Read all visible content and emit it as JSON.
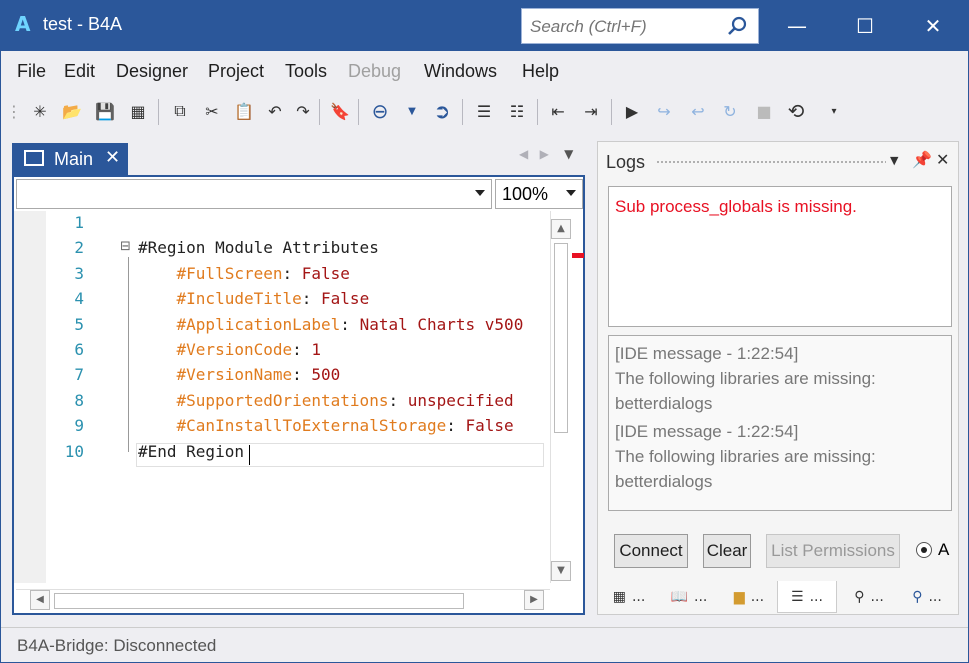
{
  "window": {
    "title": "test - B4A",
    "app_icon": "A",
    "search_placeholder": "Search (Ctrl+F)",
    "controls": {
      "minimize": "—",
      "maximize": "☐",
      "close": "✕"
    }
  },
  "menu": [
    "File",
    "Edit",
    "Designer",
    "Project",
    "Tools",
    "Debug",
    "Windows",
    "Help"
  ],
  "menu_disabled": [
    "Debug"
  ],
  "editor": {
    "tab_label": "Main",
    "tab_close": "✕",
    "module_combo_value": "",
    "zoom": "100%",
    "lines": [
      {
        "n": "1",
        "fold": "",
        "indent": "",
        "key": "",
        "sep": "",
        "value": ""
      },
      {
        "n": "2",
        "fold": "⊟",
        "indent": "",
        "key": "",
        "sep": "",
        "plain": "#Region Module Attributes"
      },
      {
        "n": "3",
        "fold": "",
        "indent": "    ",
        "key": "#FullScreen",
        "sep": ": ",
        "value": "False"
      },
      {
        "n": "4",
        "fold": "",
        "indent": "    ",
        "key": "#IncludeTitle",
        "sep": ": ",
        "value": "False"
      },
      {
        "n": "5",
        "fold": "",
        "indent": "    ",
        "key": "#ApplicationLabel",
        "sep": ": ",
        "value": "Natal Charts v500"
      },
      {
        "n": "6",
        "fold": "",
        "indent": "    ",
        "key": "#VersionCode",
        "sep": ": ",
        "value": "1"
      },
      {
        "n": "7",
        "fold": "",
        "indent": "    ",
        "key": "#VersionName",
        "sep": ": ",
        "value": "500"
      },
      {
        "n": "8",
        "fold": "",
        "indent": "    ",
        "key": "#SupportedOrientations",
        "sep": ": ",
        "value": "unspecified"
      },
      {
        "n": "9",
        "fold": "",
        "indent": "    ",
        "key": "#CanInstallToExternalStorage",
        "sep": ": ",
        "value": "False"
      },
      {
        "n": "10",
        "fold": "",
        "indent": "",
        "key": "",
        "sep": "",
        "plain": "#End Region"
      }
    ]
  },
  "logs": {
    "title": "Logs",
    "error": "Sub process_globals is missing.",
    "messages": [
      "[IDE message - 1:22:54]",
      "The following libraries are missing:",
      "betterdialogs",
      "[IDE message - 1:22:54]",
      "The following libraries are missing:",
      "betterdialogs"
    ],
    "buttons": {
      "connect": "Connect",
      "clear": "Clear",
      "list_permissions": "List Permissions"
    },
    "radio_label": "A"
  },
  "bottom_tabs": [
    "...",
    "...",
    "...",
    "...",
    "...",
    "..."
  ],
  "status": "B4A-Bridge: Disconnected",
  "colors": {
    "accent": "#2b579a",
    "keyword": "#e07b1e",
    "value": "#a31515",
    "line_number": "#2b91af",
    "error": "#e81123"
  }
}
